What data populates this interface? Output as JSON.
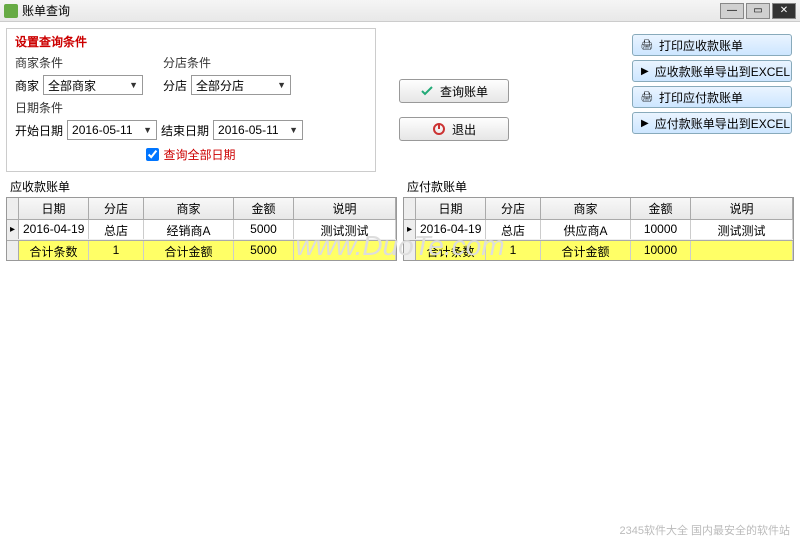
{
  "window": {
    "title": "账单查询"
  },
  "conditions": {
    "title": "设置查询条件",
    "merchant": {
      "label": "商家条件",
      "field": "商家",
      "value": "全部商家"
    },
    "branch": {
      "label": "分店条件",
      "field": "分店",
      "value": "全部分店"
    },
    "date": {
      "label": "日期条件",
      "start_field": "开始日期",
      "start_value": "2016-05-11",
      "end_field": "结束日期",
      "end_value": "2016-05-11"
    },
    "all_dates_label": "查询全部日期",
    "all_dates_checked": true
  },
  "buttons": {
    "query": "查询账单",
    "exit": "退出",
    "print_recv": "打印应收款账单",
    "export_recv": "应收款账单导出到EXCEL",
    "print_pay": "打印应付款账单",
    "export_pay": "应付款账单导出到EXCEL"
  },
  "receivable": {
    "title": "应收款账单",
    "headers": [
      "日期",
      "分店",
      "商家",
      "金额",
      "说明"
    ],
    "rows": [
      {
        "date": "2016-04-19",
        "branch": "总店",
        "merchant": "经销商A",
        "amount": "5000",
        "note": "测试测试"
      }
    ],
    "footer": {
      "count_label": "合计条数",
      "count": "1",
      "amount_label": "合计金额",
      "amount": "5000"
    }
  },
  "payable": {
    "title": "应付款账单",
    "headers": [
      "日期",
      "分店",
      "商家",
      "金额",
      "说明"
    ],
    "rows": [
      {
        "date": "2016-04-19",
        "branch": "总店",
        "merchant": "供应商A",
        "amount": "10000",
        "note": "测试测试"
      }
    ],
    "footer": {
      "count_label": "合计条数",
      "count": "1",
      "amount_label": "合计金额",
      "amount": "10000"
    }
  },
  "watermark": "www.DuoTe.com",
  "bottom_watermark": "2345软件大全\n国内最安全的软件站"
}
